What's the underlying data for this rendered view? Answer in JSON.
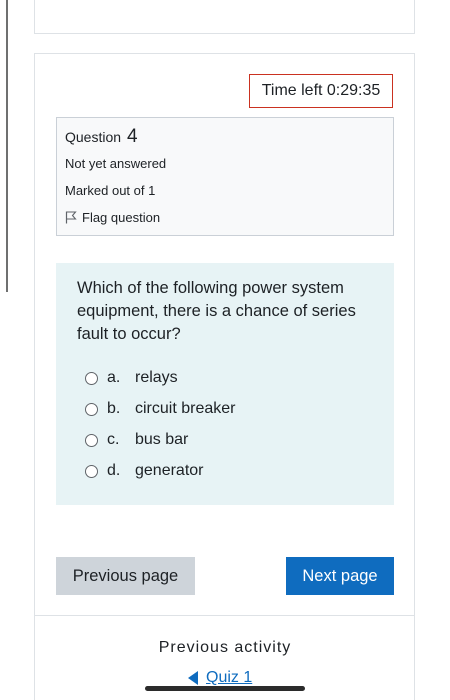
{
  "timer": {
    "label": "Time left 0:29:35"
  },
  "question_info": {
    "question_label": "Question",
    "question_number": "4",
    "state": "Not yet answered",
    "grade": "Marked out of 1",
    "flag_label": "Flag question"
  },
  "question": {
    "text": "Which of the following power system equipment, there is a chance of series fault to occur?",
    "answers": [
      {
        "letter": "a.",
        "text": "relays"
      },
      {
        "letter": "b.",
        "text": "circuit breaker"
      },
      {
        "letter": "c.",
        "text": "bus bar"
      },
      {
        "letter": "d.",
        "text": "generator"
      }
    ]
  },
  "navigation": {
    "previous_label": "Previous page",
    "next_label": "Next page"
  },
  "activity_nav": {
    "heading": "Previous activity",
    "link_label": "Quiz 1"
  },
  "colors": {
    "primary": "#0f6cbf",
    "timer_border": "#ca3120",
    "question_bg": "#e7f3f5",
    "secondary_button": "#ced4da"
  }
}
